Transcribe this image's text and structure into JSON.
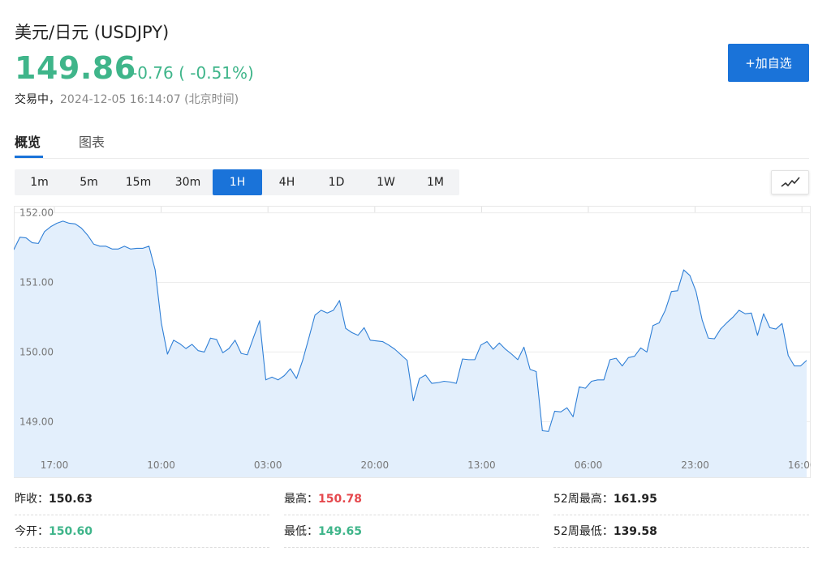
{
  "header": {
    "title": "美元/日元  (USDJPY)",
    "price": "149.86",
    "change": "-0.76 ( -0.51%)",
    "status_label": "交易中，",
    "timestamp": "2024-12-05 16:14:07 (北京时间)"
  },
  "watchlist_button": "+加自选",
  "tabs": [
    {
      "label": "概览",
      "active": true
    },
    {
      "label": "图表",
      "active": false
    }
  ],
  "intervals": [
    {
      "label": "1m",
      "active": false
    },
    {
      "label": "5m",
      "active": false
    },
    {
      "label": "15m",
      "active": false
    },
    {
      "label": "30m",
      "active": false
    },
    {
      "label": "1H",
      "active": true
    },
    {
      "label": "4H",
      "active": false
    },
    {
      "label": "1D",
      "active": false
    },
    {
      "label": "1W",
      "active": false
    },
    {
      "label": "1M",
      "active": false
    }
  ],
  "chart_toggle_icon": "line-chart-icon",
  "colors": {
    "accent": "#1a73d9",
    "price_down": "#3fb58a",
    "price_up": "#e5484d",
    "line": "#2f7fd6",
    "area": "#e3effc"
  },
  "chart_data": {
    "type": "area",
    "title": "",
    "xlabel": "",
    "ylabel": "",
    "ylim": [
      148.55,
      152.1
    ],
    "yticks": [
      {
        "value": 152.0,
        "label": "152.00"
      },
      {
        "value": 151.0,
        "label": "151.00"
      },
      {
        "value": 150.0,
        "label": "150.00"
      },
      {
        "value": 149.0,
        "label": "149.00"
      }
    ],
    "xticks": [
      "17:00",
      "10:00",
      "03:00",
      "20:00",
      "13:00",
      "06:00",
      "23:00",
      "16:00"
    ],
    "grid": true,
    "series": [
      {
        "values": [
          151.47,
          151.65,
          151.64,
          151.57,
          151.56,
          151.73,
          151.8,
          151.85,
          151.88,
          151.85,
          151.84,
          151.78,
          151.68,
          151.55,
          151.52,
          151.52,
          151.48,
          151.48,
          151.52,
          151.48,
          151.49,
          151.49,
          151.52,
          151.18,
          150.42,
          149.97,
          150.17,
          150.12,
          150.05,
          150.11,
          150.02,
          150.0,
          150.2,
          150.18,
          149.99,
          150.05,
          150.17,
          149.98,
          149.96,
          150.21,
          150.45,
          149.6,
          149.64,
          149.6,
          149.66,
          149.76,
          149.62,
          149.88,
          150.2,
          150.53,
          150.6,
          150.56,
          150.6,
          150.74,
          150.34,
          150.28,
          150.24,
          150.35,
          150.17,
          150.16,
          150.15,
          150.1,
          150.04,
          149.96,
          149.88,
          149.3,
          149.62,
          149.67,
          149.55,
          149.56,
          149.58,
          149.57,
          149.55,
          149.9,
          149.89,
          149.89,
          150.1,
          150.15,
          150.04,
          150.13,
          150.04,
          149.97,
          149.89,
          150.07,
          149.75,
          149.72,
          148.87,
          148.86,
          149.15,
          149.14,
          149.2,
          149.07,
          149.5,
          149.48,
          149.58,
          149.6,
          149.6,
          149.89,
          149.91,
          149.8,
          149.92,
          149.94,
          150.06,
          150.0,
          150.38,
          150.42,
          150.6,
          150.87,
          150.88,
          151.18,
          151.1,
          150.87,
          150.46,
          150.2,
          150.19,
          150.33,
          150.42,
          150.5,
          150.6,
          150.55,
          150.56,
          150.24,
          150.55,
          150.35,
          150.33,
          150.41,
          149.95,
          149.8,
          149.8,
          149.88
        ]
      }
    ]
  },
  "stats": [
    {
      "label": "昨收：",
      "value": "150.63",
      "tone": "neutral"
    },
    {
      "label": "最高：",
      "value": "150.78",
      "tone": "up"
    },
    {
      "label": "52周最高：",
      "value": "161.95",
      "tone": "neutral"
    },
    {
      "label": "今开：",
      "value": "150.60",
      "tone": "down"
    },
    {
      "label": "最低：",
      "value": "149.65",
      "tone": "down"
    },
    {
      "label": "52周最低：",
      "value": "139.58",
      "tone": "neutral"
    }
  ]
}
